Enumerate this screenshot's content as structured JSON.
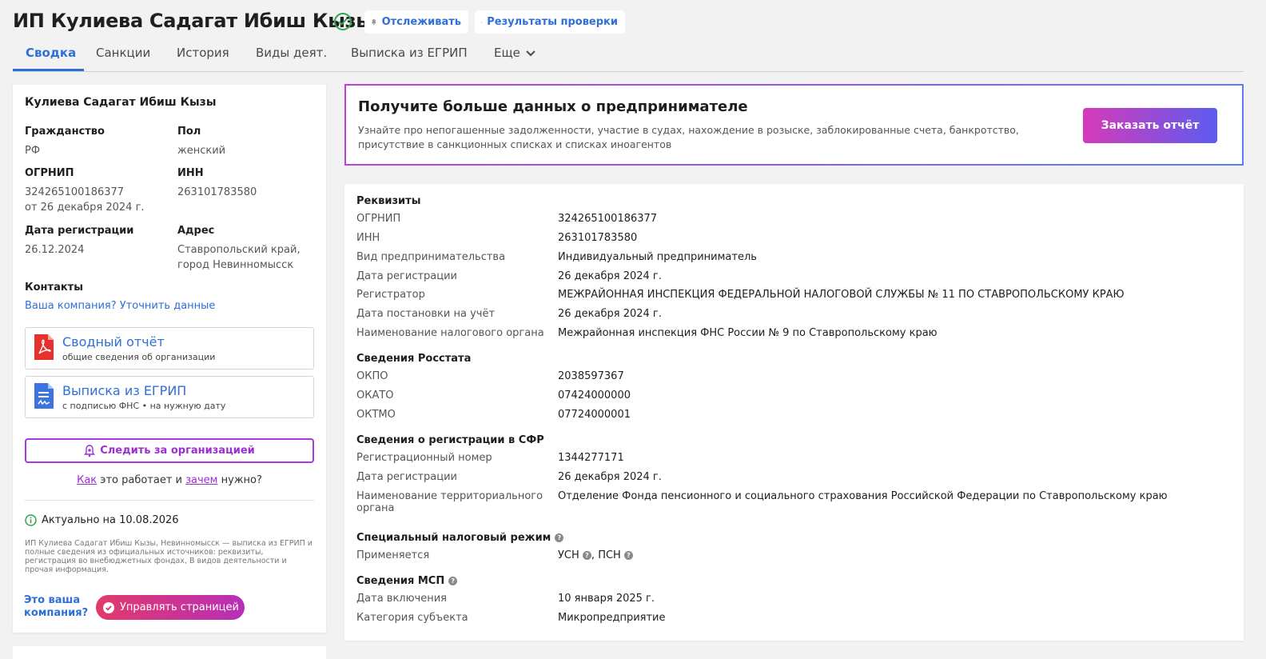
{
  "header": {
    "title": "ИП Кулиева Садагат Ибиш Кызы",
    "track_label": "Отслеживать",
    "check_label": "Результаты проверки"
  },
  "tabs": [
    {
      "label": "Сводка",
      "active": true
    },
    {
      "label": "Санкции"
    },
    {
      "label": "История"
    },
    {
      "label": "Виды деят."
    },
    {
      "label": "Выписка из ЕГРИП"
    },
    {
      "label": "Еще"
    }
  ],
  "left": {
    "name": "Кулиева Садагат Ибиш Кызы",
    "citizenship_label": "Гражданство",
    "citizenship": "РФ",
    "sex_label": "Пол",
    "sex": "женский",
    "ogrnip_label": "ОГРНИП",
    "ogrnip": "324265100186377",
    "ogrnip_date": "от 26 декабря 2024 г.",
    "inn_label": "ИНН",
    "inn": "263101783580",
    "regdate_label": "Дата регистрации",
    "regdate": "26.12.2024",
    "address_label": "Адрес",
    "address_line1": "Ставропольский край,",
    "address_line2": "город Невинномысск",
    "contacts_label": "Контакты",
    "contacts_link": "Ваша компания? Уточнить данные",
    "doc1_title": "Сводный отчёт",
    "doc1_sub": "общие сведения об организации",
    "doc2_title": "Выписка из ЕГРИП",
    "doc2_sub": "с подписью ФНС • на нужную дату",
    "follow_label": "Следить за организацией",
    "how_a": "Как",
    "how_b": " это работает и ",
    "how_c": "зачем",
    "how_d": " нужно?",
    "actual": "Актуально на 10.08.2026",
    "desc": "ИП Кулиева Садагат Ибиш Кызы, Невинномысск — выписка из ЕГРИП и полные сведения из официальных источников: реквизиты, регистрация во внебюджетных фондах, В видов деятельности и прочая информация.",
    "your_company": "Это ваша компания?",
    "manage_label": "Управлять страницей"
  },
  "promo": {
    "title": "Получите больше данных о предпринимателе",
    "text": "Узнайте про непогашенные задолженности, участие в судах, нахождение в розыске, заблокированные счета, банкротство, присутствие в санкционных списках и списках иноагентов",
    "button": "Заказать отчёт"
  },
  "details": {
    "req_title": "Реквизиты",
    "req": [
      {
        "k": "ОГРНИП",
        "v": "324265100186377"
      },
      {
        "k": "ИНН",
        "v": "263101783580"
      },
      {
        "k": "Вид предпринимательства",
        "v": "Индивидуальный предприниматель"
      },
      {
        "k": "Дата регистрации",
        "v": "26 декабря 2024 г."
      },
      {
        "k": "Регистратор",
        "v": "МЕЖРАЙОННАЯ ИНСПЕКЦИЯ ФЕДЕРАЛЬНОЙ НАЛОГОВОЙ СЛУЖБЫ № 11 ПО СТАВРОПОЛЬСКОМУ КРАЮ"
      },
      {
        "k": "Дата постановки на учёт",
        "v": "26 декабря 2024 г."
      },
      {
        "k": "Наименование налогового органа",
        "v": "Межрайонная инспекция ФНС России № 9 по Ставропольскому краю"
      }
    ],
    "rosstat_title": "Сведения Росстата",
    "rosstat": [
      {
        "k": "ОКПО",
        "v": "2038597367"
      },
      {
        "k": "ОКАТО",
        "v": "07424000000"
      },
      {
        "k": "ОКТМО",
        "v": "07724000001"
      }
    ],
    "sfr_title": "Сведения о регистрации в СФР",
    "sfr": [
      {
        "k": "Регистрационный номер",
        "v": "1344277171"
      },
      {
        "k": "Дата регистрации",
        "v": "26 декабря 2024 г."
      },
      {
        "k": "Наименование территориального органа",
        "v": "Отделение Фонда пенсионного и социального страхования Российской Федерации по Ставропольскому краю"
      }
    ],
    "tax_title": "Специальный налоговый режим",
    "tax_k": "Применяется",
    "tax_v1": "УСН",
    "tax_sep": ", ",
    "tax_v2": "ПСН",
    "msp_title": "Сведения МСП",
    "msp": [
      {
        "k": "Дата включения",
        "v": "10 января 2025 г."
      },
      {
        "k": "Категория субъекта",
        "v": "Микропредприятие"
      }
    ]
  }
}
